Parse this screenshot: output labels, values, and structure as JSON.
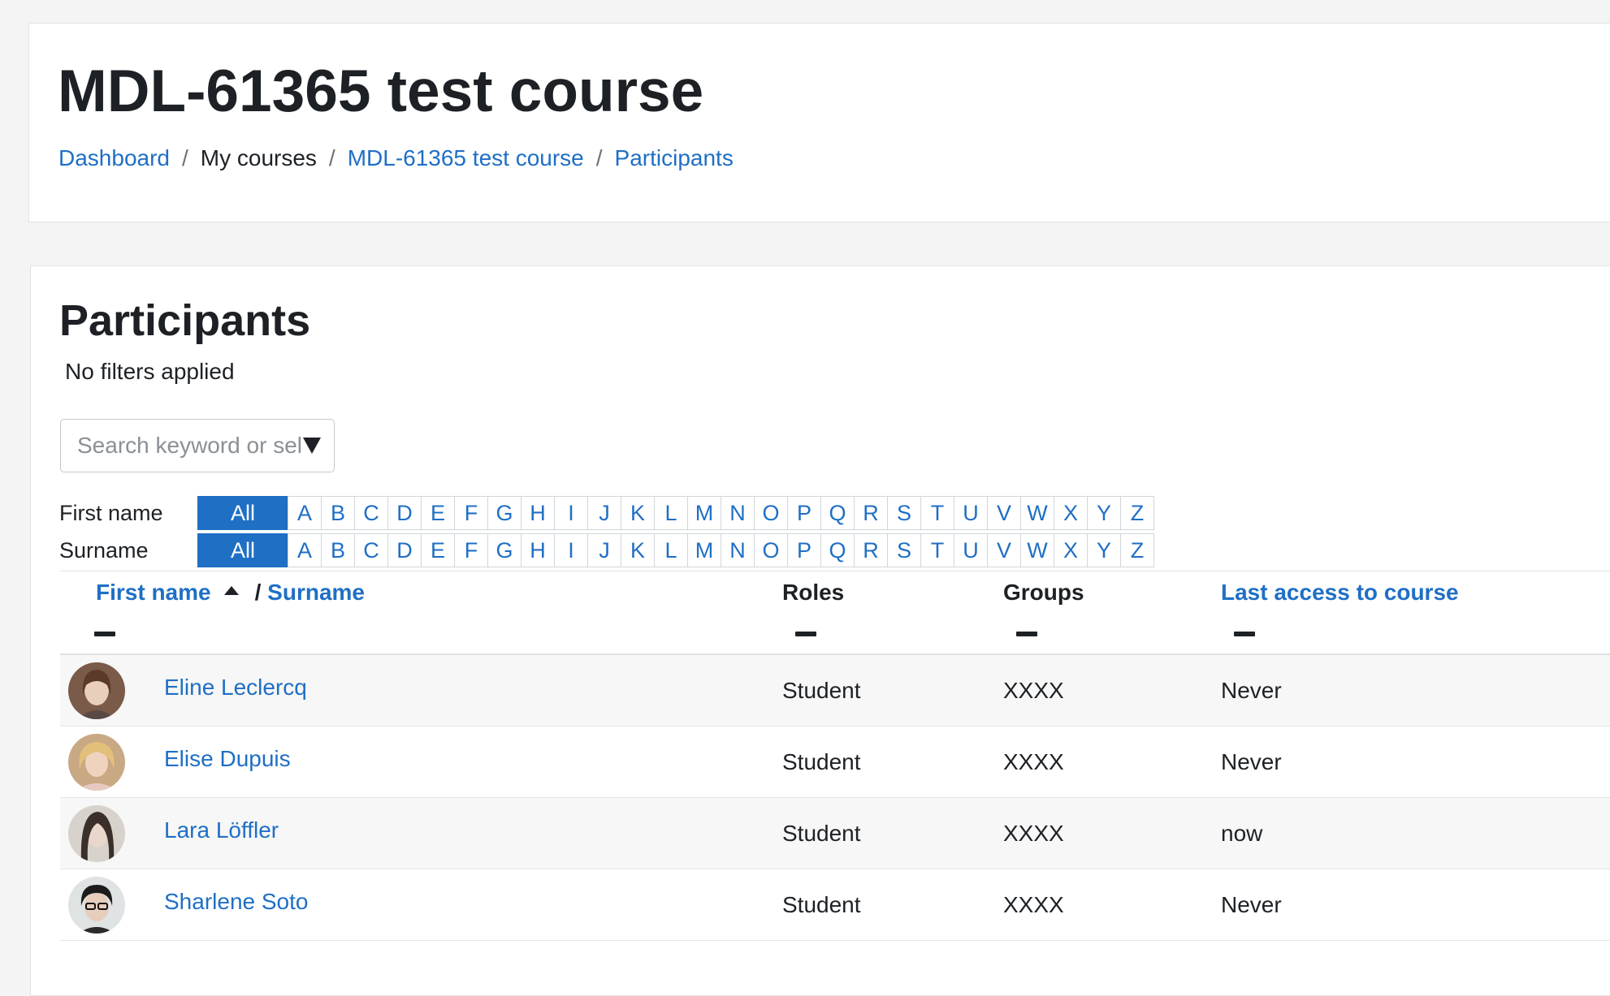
{
  "header": {
    "course_title": "MDL-61365 test course",
    "breadcrumb": [
      {
        "label": "Dashboard",
        "link": true
      },
      {
        "label": "My courses",
        "link": false
      },
      {
        "label": "MDL-61365 test course",
        "link": true
      },
      {
        "label": "Participants",
        "link": true
      }
    ]
  },
  "main": {
    "title": "Participants",
    "filters_status": "No filters applied",
    "search": {
      "placeholder": "Search keyword or sel"
    },
    "initials": {
      "first_label": "First name",
      "last_label": "Surname",
      "all_label": "All",
      "letters": [
        "A",
        "B",
        "C",
        "D",
        "E",
        "F",
        "G",
        "H",
        "I",
        "J",
        "K",
        "L",
        "M",
        "N",
        "O",
        "P",
        "Q",
        "R",
        "S",
        "T",
        "U",
        "V",
        "W",
        "X",
        "Y",
        "Z"
      ]
    },
    "table": {
      "headers": {
        "first_name": "First name",
        "separator": "/",
        "surname": "Surname",
        "roles": "Roles",
        "groups": "Groups",
        "last_access": "Last access to course"
      },
      "rows": [
        {
          "name": "Eline Leclercq",
          "role": "Student",
          "groups": "XXXX",
          "last_access": "Never",
          "avatar": "avatar-1"
        },
        {
          "name": "Elise Dupuis",
          "role": "Student",
          "groups": "XXXX",
          "last_access": "Never",
          "avatar": "avatar-2"
        },
        {
          "name": "Lara Löffler",
          "role": "Student",
          "groups": "XXXX",
          "last_access": "now",
          "avatar": "avatar-3"
        },
        {
          "name": "Sharlene Soto",
          "role": "Student",
          "groups": "XXXX",
          "last_access": "Never",
          "avatar": "avatar-4"
        }
      ]
    }
  },
  "colors": {
    "link": "#1f6fc5",
    "text": "#1d2125",
    "background": "#f4f4f4",
    "row_stripe": "#f7f7f7"
  }
}
